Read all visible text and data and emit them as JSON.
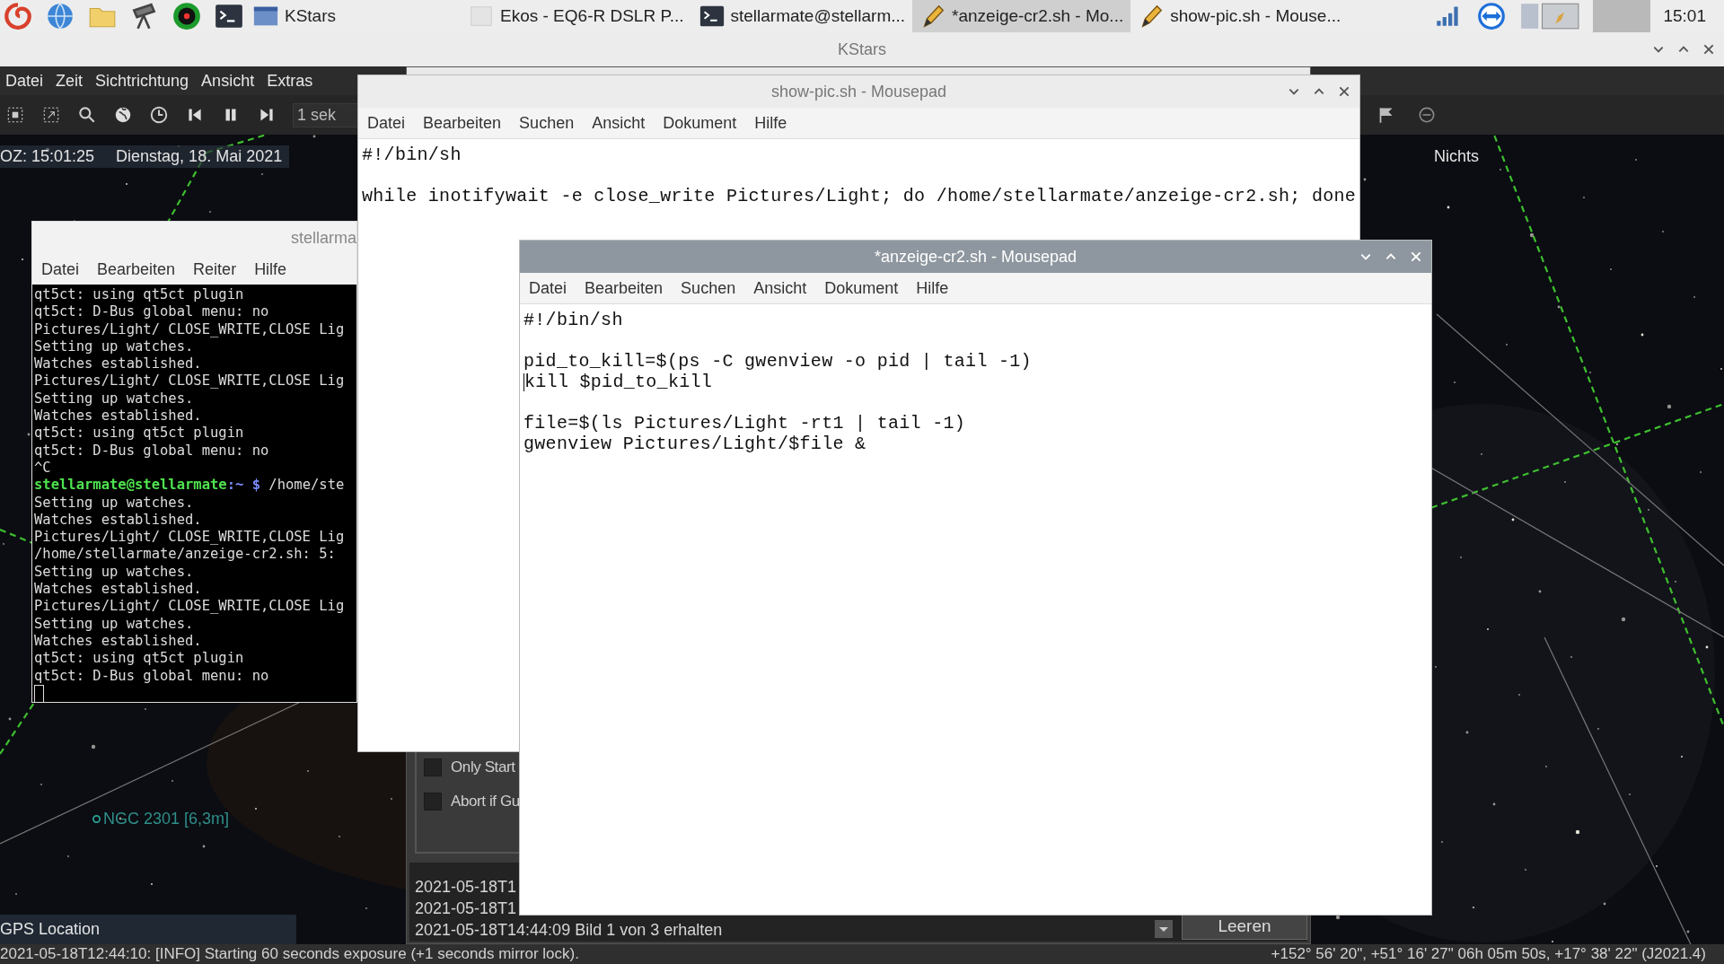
{
  "taskbar": {
    "tasks": [
      {
        "kind": "kstars",
        "label": "KStars",
        "selected": false
      },
      {
        "kind": "ekos",
        "label": "Ekos - EQ6-R DSLR P...",
        "selected": false
      },
      {
        "kind": "terminal",
        "label": "stellarmate@stellarm...",
        "selected": false
      },
      {
        "kind": "editor",
        "label": "*anzeige-cr2.sh - Mo...",
        "selected": true
      },
      {
        "kind": "editor",
        "label": "show-pic.sh - Mouse...",
        "selected": false
      }
    ],
    "clock": "15:01"
  },
  "kstars": {
    "title": "KStars",
    "menu": [
      "Datei",
      "Zeit",
      "Sichtrichtung",
      "Ansicht",
      "Extras"
    ],
    "time_step": "1 sek",
    "local_time": "OZ: 15:01:25",
    "date": "Dienstag, 18. Mai 2021",
    "focus": "Nichts",
    "object_label": "NGC 2301 [6,3m]",
    "location": "GPS Location",
    "status_message": "2021-05-18T12:44:10: [INFO] Starting 60 seconds exposure (+1 seconds mirror lock).",
    "coordinates": "+152° 56' 20\", +51° 16' 27\"  06h 05m 50s, +17° 38' 22\" (J2021.4)"
  },
  "ekos": {
    "options": [
      {
        "label": "Only Start",
        "checked": false
      },
      {
        "label": "Abort if Gu",
        "checked": false
      }
    ],
    "log": [
      "2021-05-18T1",
      "2021-05-18T1",
      "2021-05-18T14:44:09 Bild 1 von 3 erhalten"
    ],
    "clear_button": "Leeren"
  },
  "terminal": {
    "title": "stellarma",
    "menu": [
      "Datei",
      "Bearbeiten",
      "Reiter",
      "Hilfe"
    ],
    "lines": [
      {
        "kind": "output",
        "text": "qt5ct: using qt5ct plugin"
      },
      {
        "kind": "output",
        "text": "qt5ct: D-Bus global menu: no"
      },
      {
        "kind": "output",
        "text": "Pictures/Light/ CLOSE_WRITE,CLOSE Lig"
      },
      {
        "kind": "output",
        "text": "Setting up watches."
      },
      {
        "kind": "output",
        "text": "Watches established."
      },
      {
        "kind": "output",
        "text": "Pictures/Light/ CLOSE_WRITE,CLOSE Lig"
      },
      {
        "kind": "output",
        "text": "Setting up watches."
      },
      {
        "kind": "output",
        "text": "Watches established."
      },
      {
        "kind": "output",
        "text": "qt5ct: using qt5ct plugin"
      },
      {
        "kind": "output",
        "text": "qt5ct: D-Bus global menu: no"
      },
      {
        "kind": "output",
        "text": "^C"
      },
      {
        "kind": "prompt",
        "user": "stellarmate@stellarmate",
        "path": ":~ $",
        "command": "/home/ste"
      },
      {
        "kind": "output",
        "text": "Setting up watches."
      },
      {
        "kind": "output",
        "text": "Watches established."
      },
      {
        "kind": "output",
        "text": "Pictures/Light/ CLOSE_WRITE,CLOSE Lig"
      },
      {
        "kind": "output",
        "text": "/home/stellarmate/anzeige-cr2.sh: 5:"
      },
      {
        "kind": "output",
        "text": "Setting up watches."
      },
      {
        "kind": "output",
        "text": "Watches established."
      },
      {
        "kind": "output",
        "text": "Pictures/Light/ CLOSE_WRITE,CLOSE Lig"
      },
      {
        "kind": "output",
        "text": "Setting up watches."
      },
      {
        "kind": "output",
        "text": "Watches established."
      },
      {
        "kind": "output",
        "text": "qt5ct: using qt5ct plugin"
      },
      {
        "kind": "output",
        "text": "qt5ct: D-Bus global menu: no"
      },
      {
        "kind": "input"
      }
    ]
  },
  "editors": [
    {
      "title": "show-pic.sh - Mousepad",
      "active": false,
      "menu": [
        "Datei",
        "Bearbeiten",
        "Suchen",
        "Ansicht",
        "Dokument",
        "Hilfe"
      ],
      "lines": [
        {
          "kind": "code",
          "text": "#!/bin/sh",
          "cursor": false
        },
        {
          "kind": "blank"
        },
        {
          "kind": "code",
          "text": "while inotifywait -e close_write Pictures/Light; do /home/stellarmate/anzeige-cr2.sh; done",
          "cursor": false
        }
      ]
    },
    {
      "title": "*anzeige-cr2.sh - Mousepad",
      "active": true,
      "menu": [
        "Datei",
        "Bearbeiten",
        "Suchen",
        "Ansicht",
        "Dokument",
        "Hilfe"
      ],
      "lines": [
        {
          "kind": "code",
          "text": "#!/bin/sh",
          "cursor": false
        },
        {
          "kind": "blank"
        },
        {
          "kind": "code",
          "text": "pid_to_kill=$(ps -C gwenview -o pid | tail -1)",
          "cursor": false
        },
        {
          "kind": "code",
          "text": "kill $pid_to_kill",
          "cursor": true
        },
        {
          "kind": "blank"
        },
        {
          "kind": "code",
          "text": "file=$(ls Pictures/Light -rt1 | tail -1)",
          "cursor": false
        },
        {
          "kind": "code",
          "text": "gwenview Pictures/Light/$file &",
          "cursor": false
        }
      ]
    }
  ]
}
